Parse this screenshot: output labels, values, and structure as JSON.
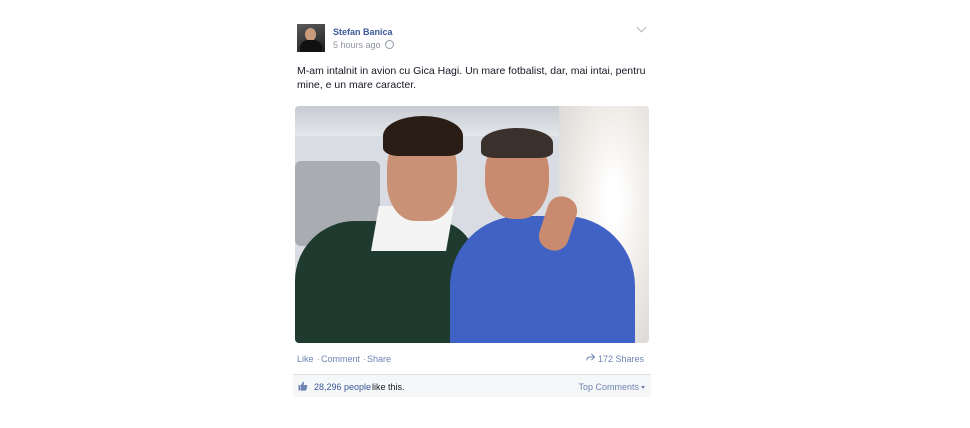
{
  "post": {
    "author": "Stefan Banica",
    "timestamp": "5 hours ago",
    "privacy_icon": "globe-icon",
    "text": "M-am intalnit in avion cu Gica Hagi. Un mare fotbalist, dar, mai intai, pentru mine, e un mare caracter."
  },
  "actions": {
    "like": "Like",
    "separator": "·",
    "comment": "Comment",
    "share": "Share",
    "shares_count": "172 Shares"
  },
  "likes": {
    "count": "28,296 people",
    "suffix": "like this.",
    "top_comments": "Top Comments"
  },
  "colors": {
    "link": "#3b5998",
    "action_link": "#6d84b4",
    "muted": "#9197a3",
    "likes_bar_bg": "#f6f7f9"
  }
}
